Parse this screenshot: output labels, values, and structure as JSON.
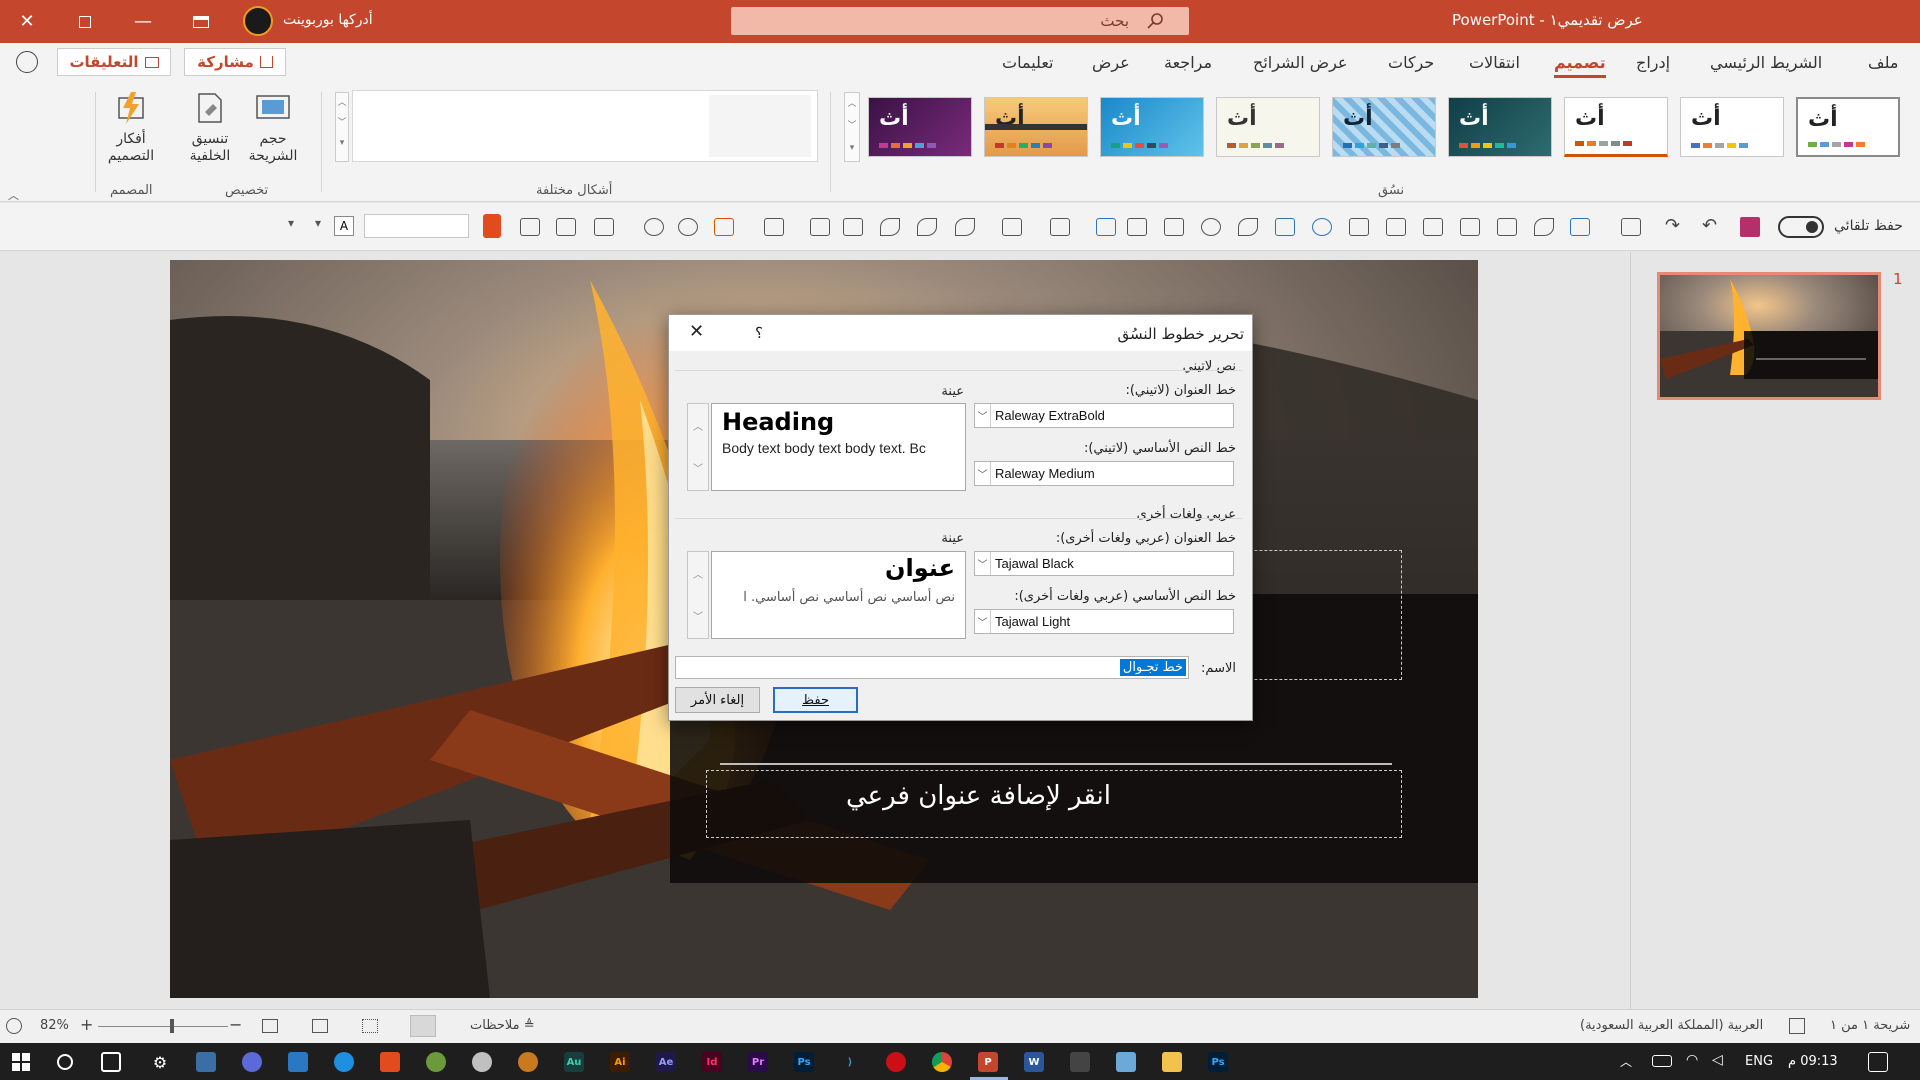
{
  "titlebar": {
    "doc_title": "عرض تقديمي١",
    "app_name": "PowerPoint",
    "separator": " - ",
    "search_placeholder": "بحث",
    "user_name": "أدركها بوربوينت"
  },
  "ribbon_tabs": [
    "ملف",
    "الشريط الرئيسي",
    "إدراج",
    "تصميم",
    "انتقالات",
    "حركات",
    "عرض الشرائح",
    "مراجعة",
    "عرض",
    "تعليمات"
  ],
  "active_tab": "تصميم",
  "share_label": "مشاركة",
  "comments_label": "التعليقات",
  "ribbon": {
    "themes_group_label": "نسُق",
    "theme_sample_text": "أث",
    "shapes_group_label": "أشكال مختلفة",
    "customize_group_label": "تخصيص",
    "designer_group_label": "المصمم",
    "slide_size_label": "حجم الشريحة",
    "format_background_label": "تنسيق الخلفية",
    "design_ideas_label": "أفكار التصميم"
  },
  "qat": {
    "autosave_label": "حفظ تلقائي"
  },
  "dialog": {
    "title": "تحرير خطوط النسُق",
    "help": "؟",
    "latin_section": "نص لاتيني",
    "latin_heading_label": "خط العنوان (لاتيني):",
    "latin_heading_font": "Raleway ExtraBold",
    "latin_body_label": "خط النص الأساسي (لاتيني):",
    "latin_body_font": "Raleway Medium",
    "sample_label": "عينة",
    "latin_sample_heading": "Heading",
    "latin_sample_body": "Body text body text body text. Bc",
    "arabic_section": "عربي ولغات أخرى",
    "arabic_heading_label": "خط العنوان (عربي ولغات أخرى):",
    "arabic_heading_font": "Tajawal Black",
    "arabic_body_label": "خط النص الأساسي (عربي ولغات أخرى):",
    "arabic_body_font": "Tajawal Light",
    "arabic_sample_heading": "عنوان",
    "arabic_sample_body": "نص أساسي نص أساسي نص أساسي. ا",
    "name_label": "الاسم:",
    "name_value": "خط تجـوال",
    "save_button": "حفظ",
    "cancel_button": "إلغاء الأمر"
  },
  "slide": {
    "subtitle_placeholder": "انقر لإضافة عنوان فرعي",
    "thumbnail_number": "1"
  },
  "statusbar": {
    "slide_counter": "شريحة ١ من ١",
    "language": "العربية (المملكة العربية السعودية)",
    "notes_label": "ملاحظات",
    "zoom": "82%"
  },
  "taskbar": {
    "time": "09:13 م",
    "lang": "ENG"
  },
  "colors": {
    "accent": "#c4472d",
    "dialog_primary_border": "#2a6cc4"
  }
}
